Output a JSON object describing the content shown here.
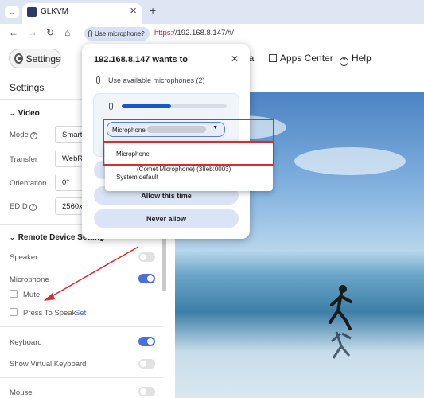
{
  "browser": {
    "tab_title": "GLKVM",
    "new_tab": "+",
    "tab_close": "✕",
    "site_chip": "Use microphone?",
    "url_scheme": "https",
    "url_rest": "://192.168.8.147/#/"
  },
  "header": {
    "settings_label": "Settings",
    "media_partial": "ia",
    "apps_center": "Apps Center",
    "help": "Help"
  },
  "sidebar": {
    "title": "Settings",
    "video_section": "Video",
    "mode_label": "Mode",
    "mode_value": "Smart",
    "transfer_label": "Transfer",
    "transfer_value": "WebR",
    "orientation_label": "Orientation",
    "orientation_value": "0°",
    "edid_label": "EDID",
    "edid_value": "2560x",
    "remote_section": "Remote Device Setting",
    "speaker_label": "Speaker",
    "speaker_on": false,
    "microphone_label": "Microphone",
    "microphone_on": true,
    "mute_label": "Mute",
    "press_to_speak_label": "Press To Speak",
    "set_link": "Set",
    "keyboard_label": "Keyboard",
    "keyboard_on": true,
    "virtual_keyboard_label": "Show Virtual Keyboard",
    "virtual_keyboard_on": false,
    "mouse_label": "Mouse",
    "mouse_on": false
  },
  "permission_popup": {
    "title": "192.168.8.147 wants to",
    "subtitle": "Use available microphones (2)",
    "dropdown_value": "Microphone",
    "level": 0.47,
    "options": [
      "Microphone",
      "(Comet Microphone) (38eb:0003)",
      "System default"
    ],
    "allow_this_time": "Allow this time",
    "never_allow": "Never allow"
  },
  "colors": {
    "accent": "#4a6fd8",
    "annotation": "#d92c2c"
  }
}
